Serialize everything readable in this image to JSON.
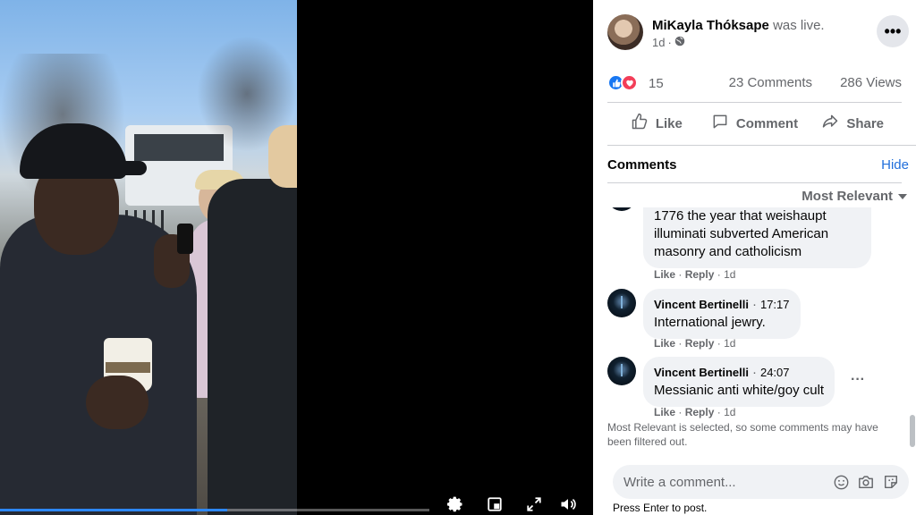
{
  "post": {
    "author": "MiKayla Thóksape",
    "status": "was live.",
    "time": "1d",
    "visibility_icon": "globe-icon",
    "reaction_count": "15",
    "comments_count": "23 Comments",
    "views_count": "286 Views"
  },
  "actions": {
    "like": "Like",
    "comment": "Comment",
    "share": "Share"
  },
  "comments_section": {
    "title": "Comments",
    "hide": "Hide",
    "sort": "Most Relevant"
  },
  "comments": [
    {
      "author": "",
      "timestamp": "",
      "text": "1776 the year that weishaupt illuminati subverted American masonry and catholicism",
      "like": "Like",
      "reply": "Reply",
      "age": "1d"
    },
    {
      "author": "Vincent Bertinelli",
      "timestamp": "17:17",
      "text": "International jewry.",
      "like": "Like",
      "reply": "Reply",
      "age": "1d"
    },
    {
      "author": "Vincent Bertinelli",
      "timestamp": "24:07",
      "text": "Messianic anti white/goy cult",
      "like": "Like",
      "reply": "Reply",
      "age": "1d"
    }
  ],
  "filter_note": "Most Relevant is selected, so some comments may have been filtered out.",
  "composer": {
    "placeholder": "Write a comment...",
    "hint": "Press Enter to post."
  },
  "video": {
    "progress": 0.53
  },
  "colors": {
    "accent_blue": "#216fdb",
    "like_blue": "#1877f2",
    "love_red": "#f33e58",
    "secondary_text": "#65676b",
    "bubble_bg": "#f0f2f5"
  }
}
